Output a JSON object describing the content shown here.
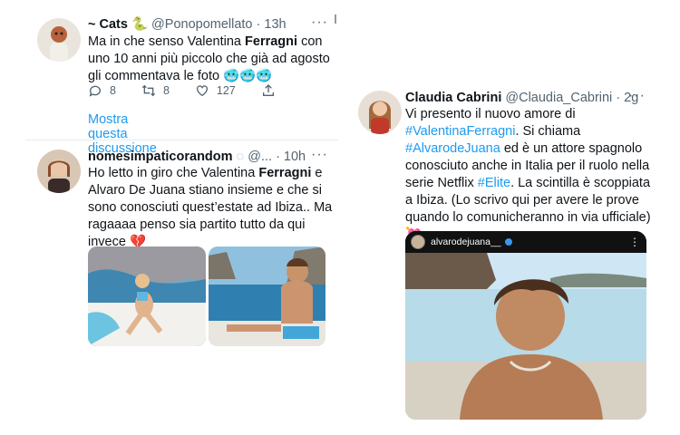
{
  "tweets": [
    {
      "name": "~ Cats 🐍",
      "handle": "@Ponopomellato",
      "time": "· 13h",
      "text_parts": [
        "Ma in che senso Valentina ",
        "Ferragni",
        " con uno 10 anni più piccolo che già ad agosto gli commentava le foto ",
        "🥶🥶🥶"
      ],
      "replies": "8",
      "retweets": "8",
      "likes": "127",
      "show_thread": "Mostra questa discussione"
    },
    {
      "name": "nomesimpaticorandom",
      "handle": "@...",
      "time": "· 10h",
      "text_parts": [
        "Ho letto in giro che Valentina ",
        "Ferragni",
        " e Alvaro De Juana stiano insieme e che si sono conosciuti quest’estate ad Ibiza.. Ma ragaaaa penso sia partito tutto da qui invece ",
        "💔"
      ]
    },
    {
      "name": "Claudia Cabrini",
      "handle": "@Claudia_Cabrini",
      "time": "· 2g",
      "text_parts": [
        "Vi presento il nuovo amore di ",
        "#ValentinaFerragni",
        ". Si chiama ",
        "#AlvarodeJuana",
        " ed è un attore spagnolo conosciuto anche in Italia per il ruolo nella serie Netflix ",
        "#Elite",
        ". La scintilla è scoppiata a Ibiza. (Lo scrivo qui per avere le prove quando lo comunicheranno in via ufficiale) ",
        "💘"
      ],
      "embed_user": "alvarodejuana__"
    }
  ],
  "icons": [
    "reply-icon",
    "retweet-icon",
    "like-icon",
    "share-icon",
    "more-icon",
    "verified-icon"
  ],
  "colors": {
    "link": "#1d9bf0",
    "muted": "#536471",
    "text": "#0f1419"
  }
}
